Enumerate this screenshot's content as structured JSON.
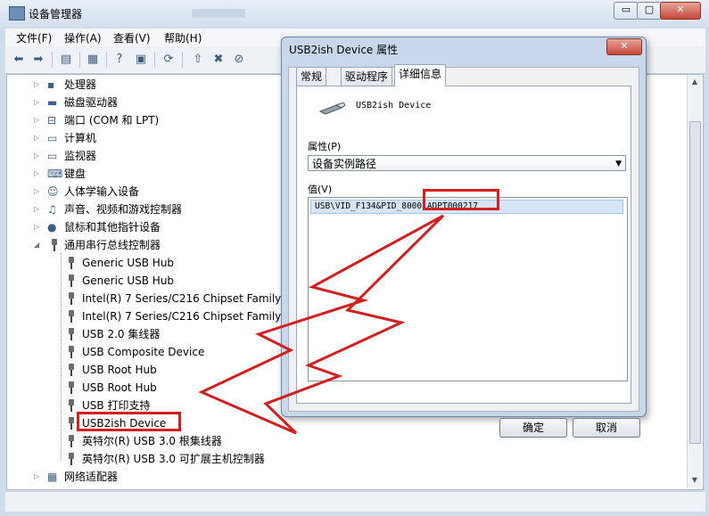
{
  "main_window": {
    "title": "设备管理器",
    "controls": {
      "minimize": "▭",
      "maximize": "▢",
      "close": "✕"
    }
  },
  "menu": [
    "文件(F)",
    "操作(A)",
    "查看(V)",
    "帮助(H)"
  ],
  "toolbar": [
    "back-icon",
    "forward-icon",
    "show-hide-icon",
    "properties-icon",
    "help-icon",
    "refresh-icon",
    "scan-icon",
    "update-driver-icon",
    "uninstall-icon",
    "disable-icon"
  ],
  "tree": [
    {
      "label": "处理器",
      "icon": "processor-icon"
    },
    {
      "label": "磁盘驱动器",
      "icon": "disk-icon"
    },
    {
      "label": "端口 (COM 和 LPT)",
      "icon": "port-icon"
    },
    {
      "label": "计算机",
      "icon": "computer-icon"
    },
    {
      "label": "监视器",
      "icon": "monitor-icon"
    },
    {
      "label": "键盘",
      "icon": "keyboard-icon"
    },
    {
      "label": "人体学输入设备",
      "icon": "hid-icon"
    },
    {
      "label": "声音、视频和游戏控制器",
      "icon": "sound-icon"
    },
    {
      "label": "鼠标和其他指针设备",
      "icon": "mouse-icon"
    },
    {
      "label": "通用串行总线控制器",
      "icon": "usb-icon"
    },
    {
      "label": "Generic USB Hub",
      "icon": "usb-icon"
    },
    {
      "label": "Generic USB Hub",
      "icon": "usb-icon"
    },
    {
      "label": "Intel(R) 7 Series/C216 Chipset Family U",
      "icon": "usb-icon"
    },
    {
      "label": "Intel(R) 7 Series/C216 Chipset Family U",
      "icon": "usb-icon"
    },
    {
      "label": "USB 2.0 集线器",
      "icon": "usb-icon"
    },
    {
      "label": "USB Composite Device",
      "icon": "usb-icon"
    },
    {
      "label": "USB Root Hub",
      "icon": "usb-icon"
    },
    {
      "label": "USB Root Hub",
      "icon": "usb-icon"
    },
    {
      "label": "USB 打印支持",
      "icon": "usb-icon"
    },
    {
      "label": "USB2ish Device",
      "icon": "usb-icon"
    },
    {
      "label": "英特尔(R) USB 3.0 根集线器",
      "icon": "usb-icon"
    },
    {
      "label": "英特尔(R) USB 3.0 可扩展主机控制器",
      "icon": "usb-icon"
    },
    {
      "label": "网络适配器",
      "icon": "network-icon"
    }
  ],
  "dialog": {
    "title": "USB2ish Device 属性",
    "close": "✕",
    "tabs": [
      "常规",
      "驱动程序",
      "详细信息"
    ],
    "device_name": "USB2ish Device",
    "property_label": "属性(P)",
    "property_value": "设备实例路径",
    "value_label": "值(V)",
    "value_text": "USB\\VID_F134&PID_8000\\ADPT000217",
    "ok": "确定",
    "cancel": "取消"
  },
  "colors": {
    "highlight": "#d21f1f",
    "selection": "#d6e6f6"
  }
}
